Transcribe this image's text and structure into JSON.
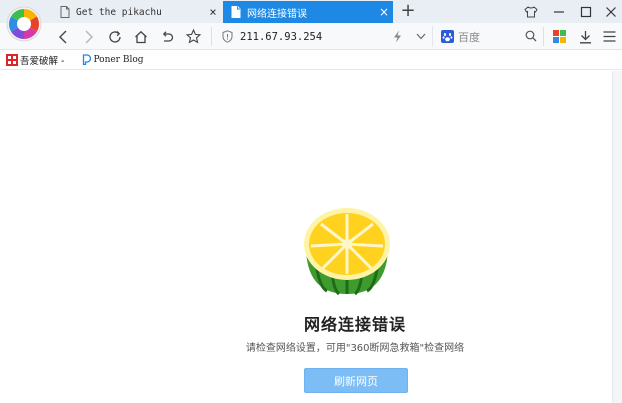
{
  "tabs": [
    {
      "title": "Get the pikachu",
      "close": "×"
    },
    {
      "title": "网络连接错误",
      "close": "×"
    }
  ],
  "new_tab_label": "+",
  "toolbar": {
    "url": "211.67.93.254",
    "search_engine": "百度"
  },
  "bookmarks": [
    {
      "label": "吾爱破解 -"
    },
    {
      "label": "Poner Blog"
    }
  ],
  "error_page": {
    "title": "网络连接错误",
    "description": "请检查网络设置，可用\"360断网急救箱\"检查网络",
    "button": "刷新网页"
  },
  "colors": {
    "active_tab": "#1e88e5",
    "button": "#7dbdf5",
    "tab_strip": "#e9eef4"
  }
}
